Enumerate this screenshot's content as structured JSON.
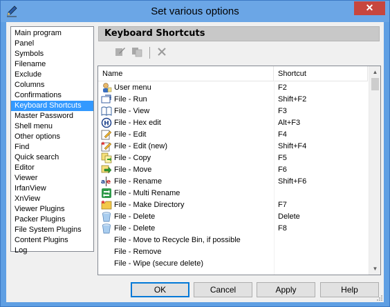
{
  "window": {
    "title": "Set various options",
    "close_label": "✕"
  },
  "categories": [
    {
      "label": "Main program",
      "selected": false
    },
    {
      "label": "Panel",
      "selected": false
    },
    {
      "label": "Symbols",
      "selected": false
    },
    {
      "label": "Filename",
      "selected": false
    },
    {
      "label": "Exclude",
      "selected": false
    },
    {
      "label": "Columns",
      "selected": false
    },
    {
      "label": "Confirmations",
      "selected": false
    },
    {
      "label": "Keyboard Shortcuts",
      "selected": true
    },
    {
      "label": "Master Password",
      "selected": false
    },
    {
      "label": "Shell menu",
      "selected": false
    },
    {
      "label": "Other options",
      "selected": false
    },
    {
      "label": "Find",
      "selected": false
    },
    {
      "label": "Quick search",
      "selected": false
    },
    {
      "label": "Editor",
      "selected": false
    },
    {
      "label": "Viewer",
      "selected": false
    },
    {
      "label": "IrfanView",
      "selected": false
    },
    {
      "label": "XnView",
      "selected": false
    },
    {
      "label": "Viewer Plugins",
      "selected": false
    },
    {
      "label": "Packer Plugins",
      "selected": false
    },
    {
      "label": "File System Plugins",
      "selected": false
    },
    {
      "label": "Content Plugins",
      "selected": false
    },
    {
      "label": "Log",
      "selected": false
    }
  ],
  "section": {
    "title": "Keyboard Shortcuts"
  },
  "toolbar": {
    "buttons": [
      {
        "icon": "edit-icon"
      },
      {
        "icon": "copy-icon"
      },
      {
        "icon": "delete-icon"
      }
    ]
  },
  "table": {
    "columns": [
      "Name",
      "Shortcut"
    ],
    "rows": [
      {
        "icon": "user-menu-icon",
        "name": "User menu",
        "shortcut": "F2"
      },
      {
        "icon": "run-icon",
        "name": "File - Run",
        "shortcut": "Shift+F2"
      },
      {
        "icon": "view-icon",
        "name": "File - View",
        "shortcut": "F3"
      },
      {
        "icon": "hex-edit-icon",
        "name": "File - Hex edit",
        "shortcut": "Alt+F3"
      },
      {
        "icon": "edit-icon",
        "name": "File - Edit",
        "shortcut": "F4"
      },
      {
        "icon": "edit-new-icon",
        "name": "File - Edit (new)",
        "shortcut": "Shift+F4"
      },
      {
        "icon": "copy-icon",
        "name": "File - Copy",
        "shortcut": "F5"
      },
      {
        "icon": "move-icon",
        "name": "File - Move",
        "shortcut": "F6"
      },
      {
        "icon": "rename-icon",
        "name": "File - Rename",
        "shortcut": "Shift+F6"
      },
      {
        "icon": "multi-rename-icon",
        "name": "File - Multi Rename",
        "shortcut": ""
      },
      {
        "icon": "make-directory-icon",
        "name": "File - Make Directory",
        "shortcut": "F7"
      },
      {
        "icon": "delete-icon",
        "name": "File - Delete",
        "shortcut": "Delete"
      },
      {
        "icon": "delete-icon",
        "name": "File - Delete",
        "shortcut": "F8"
      },
      {
        "icon": "",
        "name": "File - Move to Recycle Bin, if possible",
        "shortcut": ""
      },
      {
        "icon": "",
        "name": "File - Remove",
        "shortcut": ""
      },
      {
        "icon": "",
        "name": "File - Wipe (secure delete)",
        "shortcut": ""
      }
    ]
  },
  "buttons": {
    "ok": "OK",
    "cancel": "Cancel",
    "apply": "Apply",
    "help": "Help"
  },
  "colors": {
    "selection": "#3399ff",
    "titlebar": "#6ba6e6",
    "close": "#c7463e"
  }
}
